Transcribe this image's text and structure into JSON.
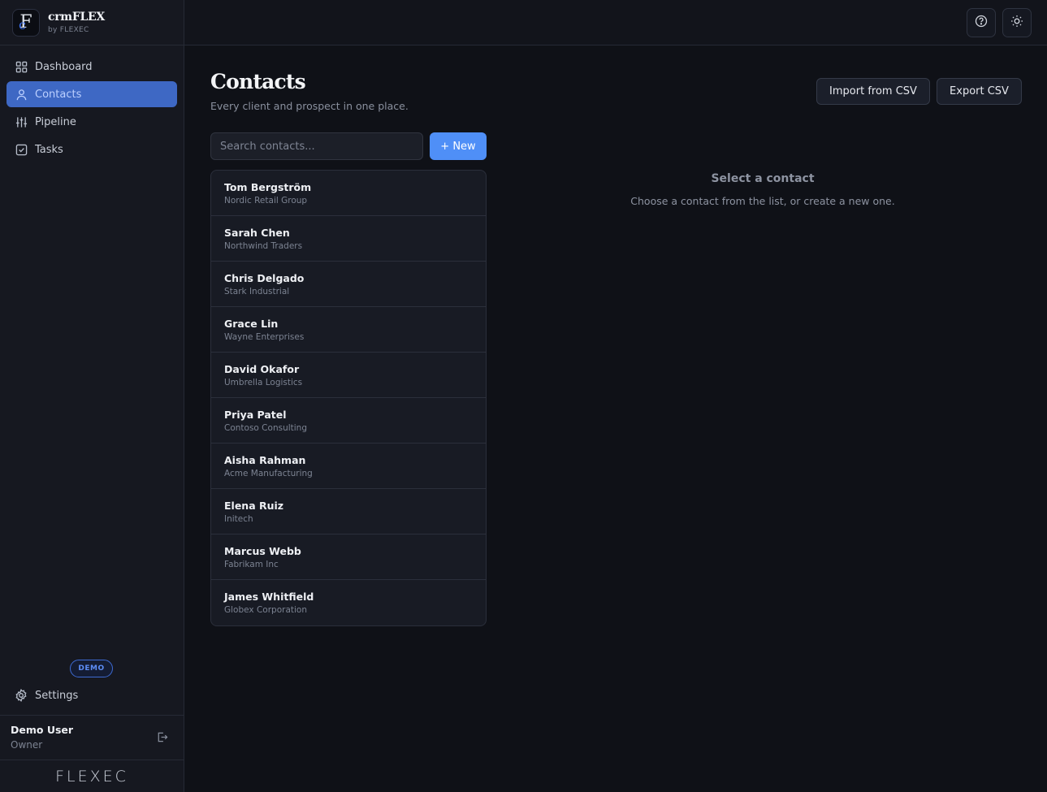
{
  "brand": {
    "name": "crmFLEX",
    "subtitle": "by FLEXEC"
  },
  "nav": [
    {
      "label": "Dashboard",
      "icon": "grid-icon",
      "active": false
    },
    {
      "label": "Contacts",
      "icon": "user-icon",
      "active": true
    },
    {
      "label": "Pipeline",
      "icon": "sliders-icon",
      "active": false
    },
    {
      "label": "Tasks",
      "icon": "checkbox-icon",
      "active": false
    }
  ],
  "badge": "DEMO",
  "settings_label": "Settings",
  "user": {
    "name": "Demo User",
    "role": "Owner"
  },
  "footer_logo": "FLEXEC",
  "page": {
    "title": "Contacts",
    "subtitle": "Every client and prospect in one place.",
    "import_label": "Import from CSV",
    "export_label": "Export CSV"
  },
  "search": {
    "placeholder": "Search contacts..."
  },
  "new_label": "+ New",
  "contacts": [
    {
      "name": "Tom Bergström",
      "company": "Nordic Retail Group"
    },
    {
      "name": "Sarah Chen",
      "company": "Northwind Traders"
    },
    {
      "name": "Chris Delgado",
      "company": "Stark Industrial"
    },
    {
      "name": "Grace Lin",
      "company": "Wayne Enterprises"
    },
    {
      "name": "David Okafor",
      "company": "Umbrella Logistics"
    },
    {
      "name": "Priya Patel",
      "company": "Contoso Consulting"
    },
    {
      "name": "Aisha Rahman",
      "company": "Acme Manufacturing"
    },
    {
      "name": "Elena Ruiz",
      "company": "Initech"
    },
    {
      "name": "Marcus Webb",
      "company": "Fabrikam Inc"
    },
    {
      "name": "James Whitfield",
      "company": "Globex Corporation"
    }
  ],
  "empty_state": {
    "title": "Select a contact",
    "subtitle": "Choose a contact from the list, or create a new one."
  },
  "colors": {
    "accent": "#4f8ff7",
    "active_nav": "#3e68c4",
    "background": "#0f1117"
  }
}
